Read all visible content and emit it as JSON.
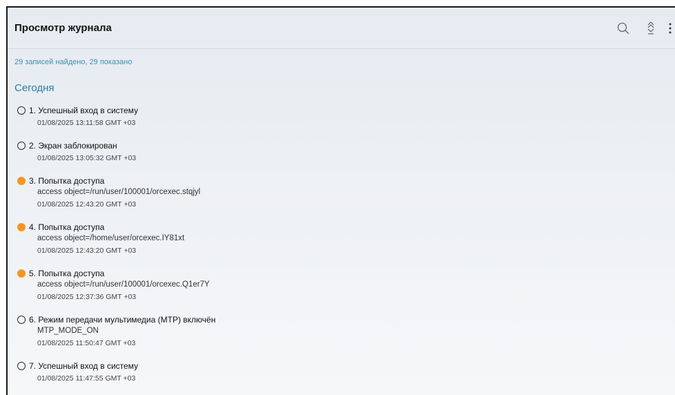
{
  "header": {
    "title": "Просмотр журнала",
    "icons": [
      "search-icon",
      "expand-collapse-icon",
      "more-vertical-icon"
    ]
  },
  "summary": "29 записей найдено, 29 показано",
  "section_title": "Сегодня",
  "colors": {
    "accent": "#2f7aa4",
    "warning": "#f59622"
  },
  "entries": [
    {
      "title": "1. Успешный вход в систему",
      "detail": "",
      "time": "01/08/2025 13:11:58 GMT +03",
      "status": "normal"
    },
    {
      "title": "2. Экран заблокирован",
      "detail": "",
      "time": "01/08/2025 13:05:32 GMT +03",
      "status": "normal"
    },
    {
      "title": "3. Попытка доступа",
      "detail": "access object=/run/user/100001/orcexec.stqjyl",
      "time": "01/08/2025 12:43:20 GMT +03",
      "status": "warning"
    },
    {
      "title": "4. Попытка доступа",
      "detail": "access object=/home/user/orcexec.IY81xt",
      "time": "01/08/2025 12:43:20 GMT +03",
      "status": "warning"
    },
    {
      "title": "5. Попытка доступа",
      "detail": "access object=/run/user/100001/orcexec.Q1er7Y",
      "time": "01/08/2025 12:37:36 GMT +03",
      "status": "warning"
    },
    {
      "title": "6. Режим передачи мультимедиа (MTP) включён",
      "detail": "MTP_MODE_ON",
      "time": "01/08/2025 11:50:47 GMT +03",
      "status": "normal"
    },
    {
      "title": "7. Успешный вход в систему",
      "detail": "",
      "time": "01/08/2025 11:47:55 GMT +03",
      "status": "normal"
    }
  ]
}
